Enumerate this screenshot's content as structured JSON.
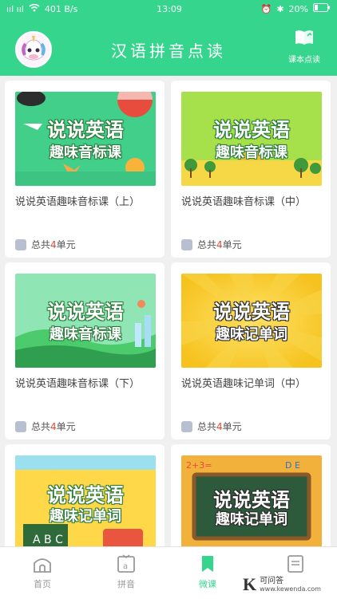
{
  "statusbar": {
    "signal": "ııl ııl",
    "speed": "401 B/s",
    "time": "13:09",
    "battery": "20%"
  },
  "header": {
    "title": "汉语拼音点读",
    "right_button_label": "课本点读",
    "right_icon": "book-icon"
  },
  "cards": [
    {
      "title": "说说英语趣味音标课（上）",
      "banner_line1": "说说英语",
      "banner_line2": "趣味音标课",
      "meta_prefix": "总共",
      "meta_count": "4",
      "meta_suffix": "单元"
    },
    {
      "title": "说说英语趣味音标课（中）",
      "banner_line1": "说说英语",
      "banner_line2": "趣味音标课",
      "meta_prefix": "总共",
      "meta_count": "4",
      "meta_suffix": "单元"
    },
    {
      "title": "说说英语趣味音标课（下）",
      "banner_line1": "说说英语",
      "banner_line2": "趣味音标课",
      "meta_prefix": "总共",
      "meta_count": "4",
      "meta_suffix": "单元"
    },
    {
      "title": "说说英语趣味记单词（中）",
      "banner_line1": "说说英语",
      "banner_line2": "趣味记单词",
      "meta_prefix": "总共",
      "meta_count": "4",
      "meta_suffix": "单元"
    },
    {
      "title": "",
      "banner_line1": "说说英语",
      "banner_line2": "趣味记单词"
    },
    {
      "title": "",
      "banner_line1": "说说英语",
      "banner_line2": "趣味记单词"
    }
  ],
  "bottom_nav": [
    {
      "label": "首页",
      "icon": "home-icon"
    },
    {
      "label": "拼音",
      "icon": "pinyin-a-icon"
    },
    {
      "label": "微课",
      "icon": "bookmark-icon"
    },
    {
      "label": "",
      "icon": "document-icon"
    }
  ],
  "watermark": {
    "letter": "K",
    "text": "可问答",
    "url": "www.kewenda.com"
  },
  "colors": {
    "accent": "#36d58e",
    "count_red": "#e6452f"
  }
}
